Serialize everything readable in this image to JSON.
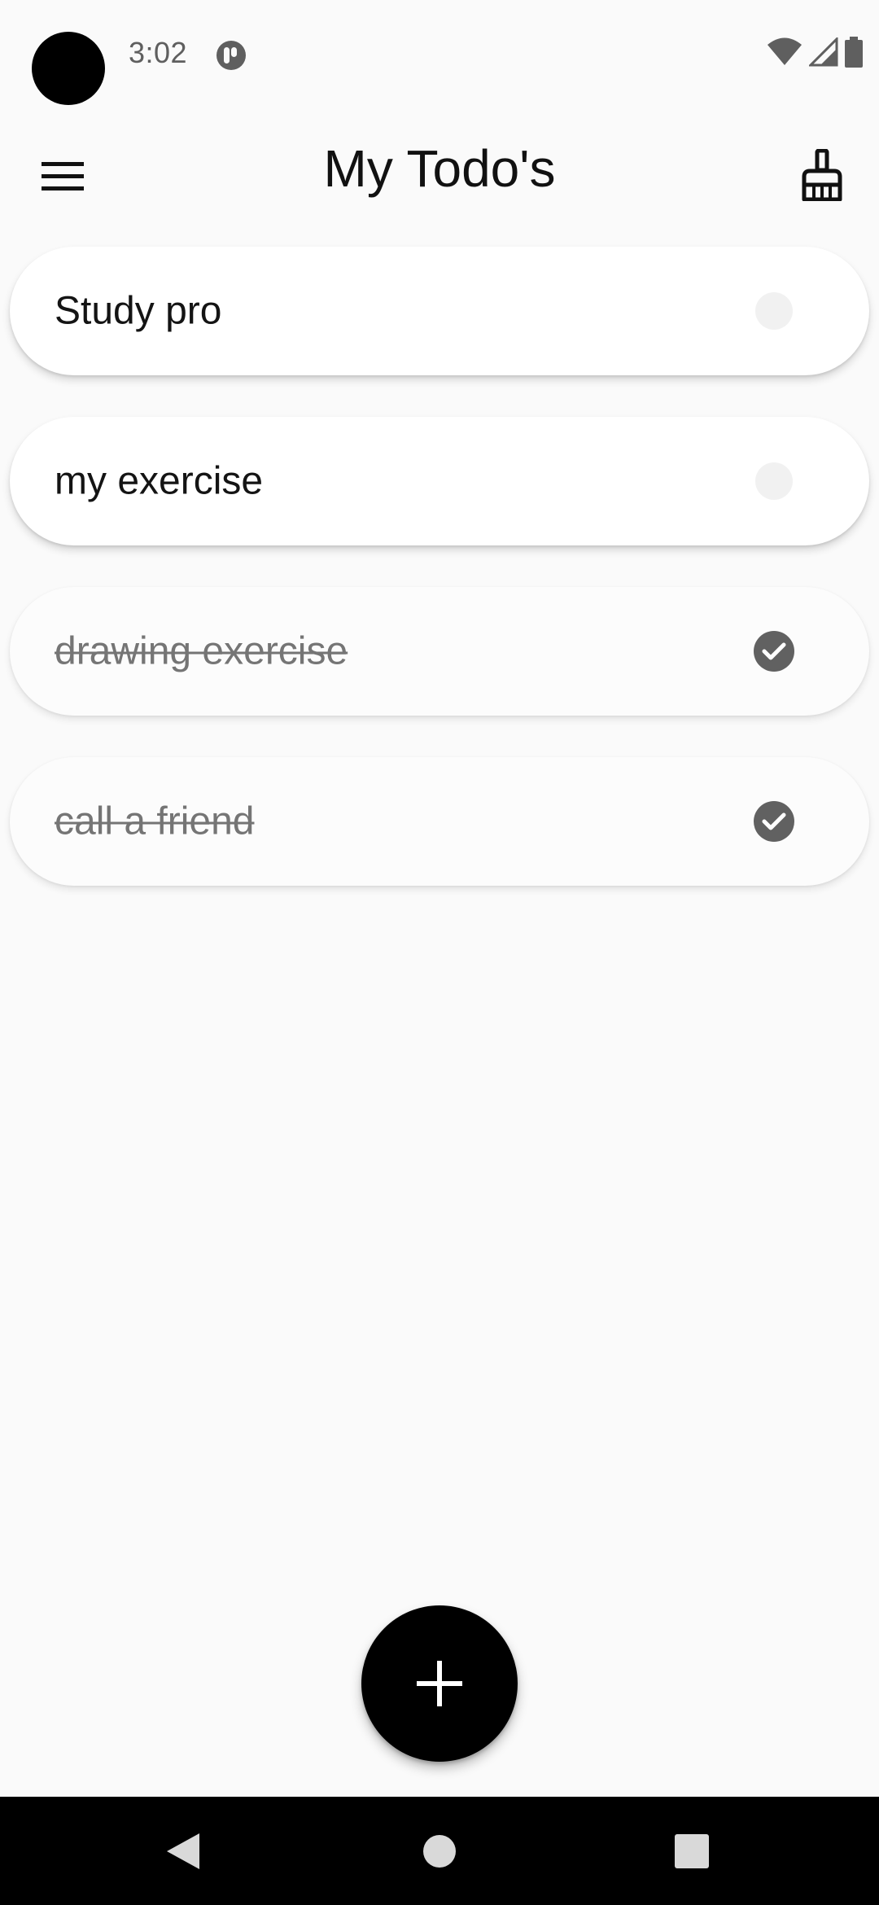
{
  "status_bar": {
    "time": "3:02",
    "app_icon": "notification-app-icon",
    "icons": [
      "wifi-icon",
      "cellular-signal-icon",
      "battery-icon"
    ]
  },
  "app_bar": {
    "title": "My Todo's",
    "menu_icon": "hamburger-menu-icon",
    "action_icon": "broom-clean-icon"
  },
  "todos": [
    {
      "text": "Study pro",
      "done": false
    },
    {
      "text": "my exercise",
      "done": false
    },
    {
      "text": "drawing exercise",
      "done": true
    },
    {
      "text": "call a friend",
      "done": true
    }
  ],
  "fab": {
    "icon": "plus-icon"
  },
  "nav_bar": {
    "buttons": [
      "back-icon",
      "home-icon",
      "recents-icon"
    ]
  },
  "colors": {
    "background": "#fafafa",
    "card": "#ffffff",
    "done_text": "#757575",
    "check": "#616161",
    "fab": "#000000",
    "nav_bar": "#000000"
  }
}
